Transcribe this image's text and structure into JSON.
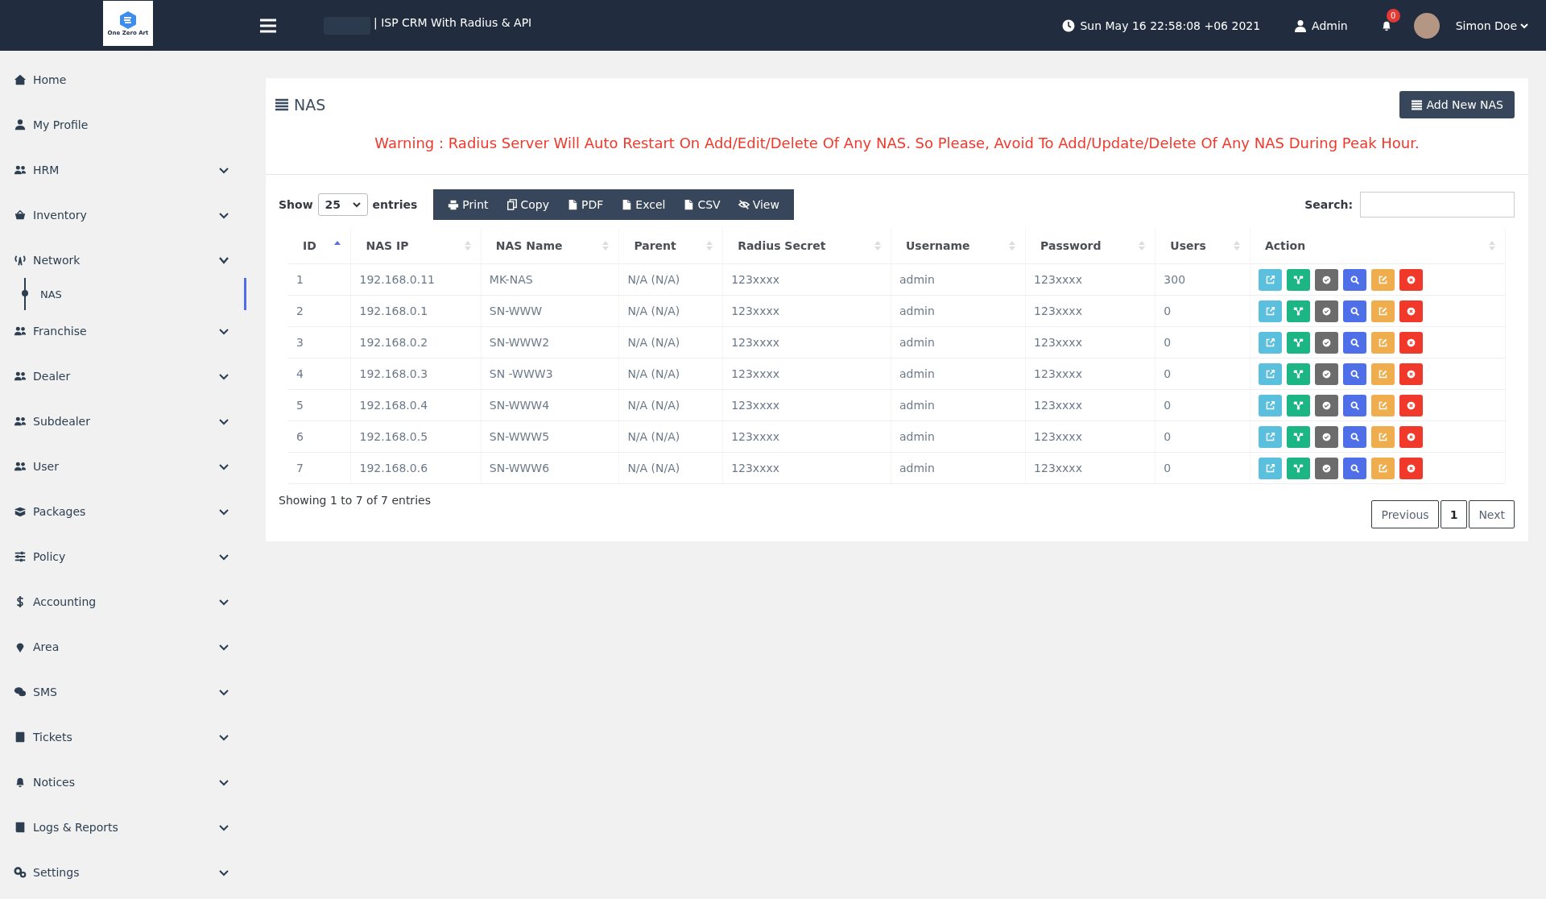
{
  "header": {
    "logo_text": "One Zero Art",
    "title": "| ISP CRM With Radius & API",
    "datetime": "Sun May 16 22:58:08 +06 2021",
    "role": "Admin",
    "notification_count": "0",
    "user_name": "Simon Doe"
  },
  "sidebar": {
    "items": [
      {
        "label": "Home"
      },
      {
        "label": "My Profile"
      },
      {
        "label": "HRM",
        "expanded": false
      },
      {
        "label": "Inventory",
        "expanded": false
      },
      {
        "label": "Network",
        "expanded": true,
        "children": [
          {
            "label": "NAS",
            "selected": true
          }
        ]
      },
      {
        "label": "Franchise",
        "expanded": false
      },
      {
        "label": "Dealer",
        "expanded": false
      },
      {
        "label": "Subdealer",
        "expanded": false
      },
      {
        "label": "User",
        "expanded": false
      },
      {
        "label": "Packages",
        "expanded": false
      },
      {
        "label": "Policy",
        "expanded": false
      },
      {
        "label": "Accounting",
        "expanded": false
      },
      {
        "label": "Area",
        "expanded": false
      },
      {
        "label": "SMS",
        "expanded": false
      },
      {
        "label": "Tickets",
        "expanded": false
      },
      {
        "label": "Notices",
        "expanded": false
      },
      {
        "label": "Logs & Reports",
        "expanded": false
      },
      {
        "label": "Settings",
        "expanded": false
      }
    ]
  },
  "page": {
    "title": "NAS",
    "add_button": "Add New NAS",
    "warning": "Warning : Radius Server Will Auto Restart On Add/Edit/Delete Of Any NAS. So Please, Avoid To Add/Update/Delete Of Any NAS During Peak Hour."
  },
  "controls": {
    "show_label": "Show",
    "entries_value": "25",
    "entries_label": "entries",
    "search_label": "Search:",
    "export_buttons": [
      {
        "label": "Print",
        "kind": "print"
      },
      {
        "label": "Copy",
        "kind": "copy"
      },
      {
        "label": "PDF",
        "kind": "pdf"
      },
      {
        "label": "Excel",
        "kind": "excel"
      },
      {
        "label": "CSV",
        "kind": "csv"
      },
      {
        "label": "View",
        "kind": "view"
      }
    ]
  },
  "table": {
    "columns": [
      {
        "label": "ID",
        "sorted": true
      },
      {
        "label": "NAS IP",
        "sorted": false
      },
      {
        "label": "NAS Name",
        "sorted": false
      },
      {
        "label": "Parent",
        "sorted": false
      },
      {
        "label": "Radius Secret",
        "sorted": false
      },
      {
        "label": "Username",
        "sorted": false
      },
      {
        "label": "Password",
        "sorted": false
      },
      {
        "label": "Users",
        "sorted": false
      },
      {
        "label": "Action",
        "sorted": false
      }
    ],
    "actions": [
      {
        "kind": "external",
        "color": "#5bc0de"
      },
      {
        "kind": "tree",
        "color": "#1cb584"
      },
      {
        "kind": "check",
        "color": "#6c6c6c"
      },
      {
        "kind": "search",
        "color": "#4f6fe8"
      },
      {
        "kind": "edit",
        "color": "#f0ad4e"
      },
      {
        "kind": "delete",
        "color": "#f0382b"
      }
    ],
    "rows": [
      [
        "1",
        "192.168.0.11",
        "MK-NAS",
        "N/A (N/A)",
        "123xxxx",
        "admin",
        "123xxxx",
        "300"
      ],
      [
        "2",
        "192.168.0.1",
        "SN-WWW",
        "N/A (N/A)",
        "123xxxx",
        "admin",
        "123xxxx",
        "0"
      ],
      [
        "3",
        "192.168.0.2",
        "SN-WWW2",
        "N/A (N/A)",
        "123xxxx",
        "admin",
        "123xxxx",
        "0"
      ],
      [
        "4",
        "192.168.0.3",
        "SN -WWW3",
        "N/A (N/A)",
        "123xxxx",
        "admin",
        "123xxxx",
        "0"
      ],
      [
        "5",
        "192.168.0.4",
        "SN-WWW4",
        "N/A (N/A)",
        "123xxxx",
        "admin",
        "123xxxx",
        "0"
      ],
      [
        "6",
        "192.168.0.5",
        "SN-WWW5",
        "N/A (N/A)",
        "123xxxx",
        "admin",
        "123xxxx",
        "0"
      ],
      [
        "7",
        "192.168.0.6",
        "SN-WWW6",
        "N/A (N/A)",
        "123xxxx",
        "admin",
        "123xxxx",
        "0"
      ]
    ]
  },
  "footer": {
    "info": "Showing 1 to 7 of 7 entries",
    "pagination": [
      {
        "label": "Previous",
        "selected": false
      },
      {
        "label": "1",
        "selected": true
      },
      {
        "label": "Next",
        "selected": false
      }
    ]
  }
}
